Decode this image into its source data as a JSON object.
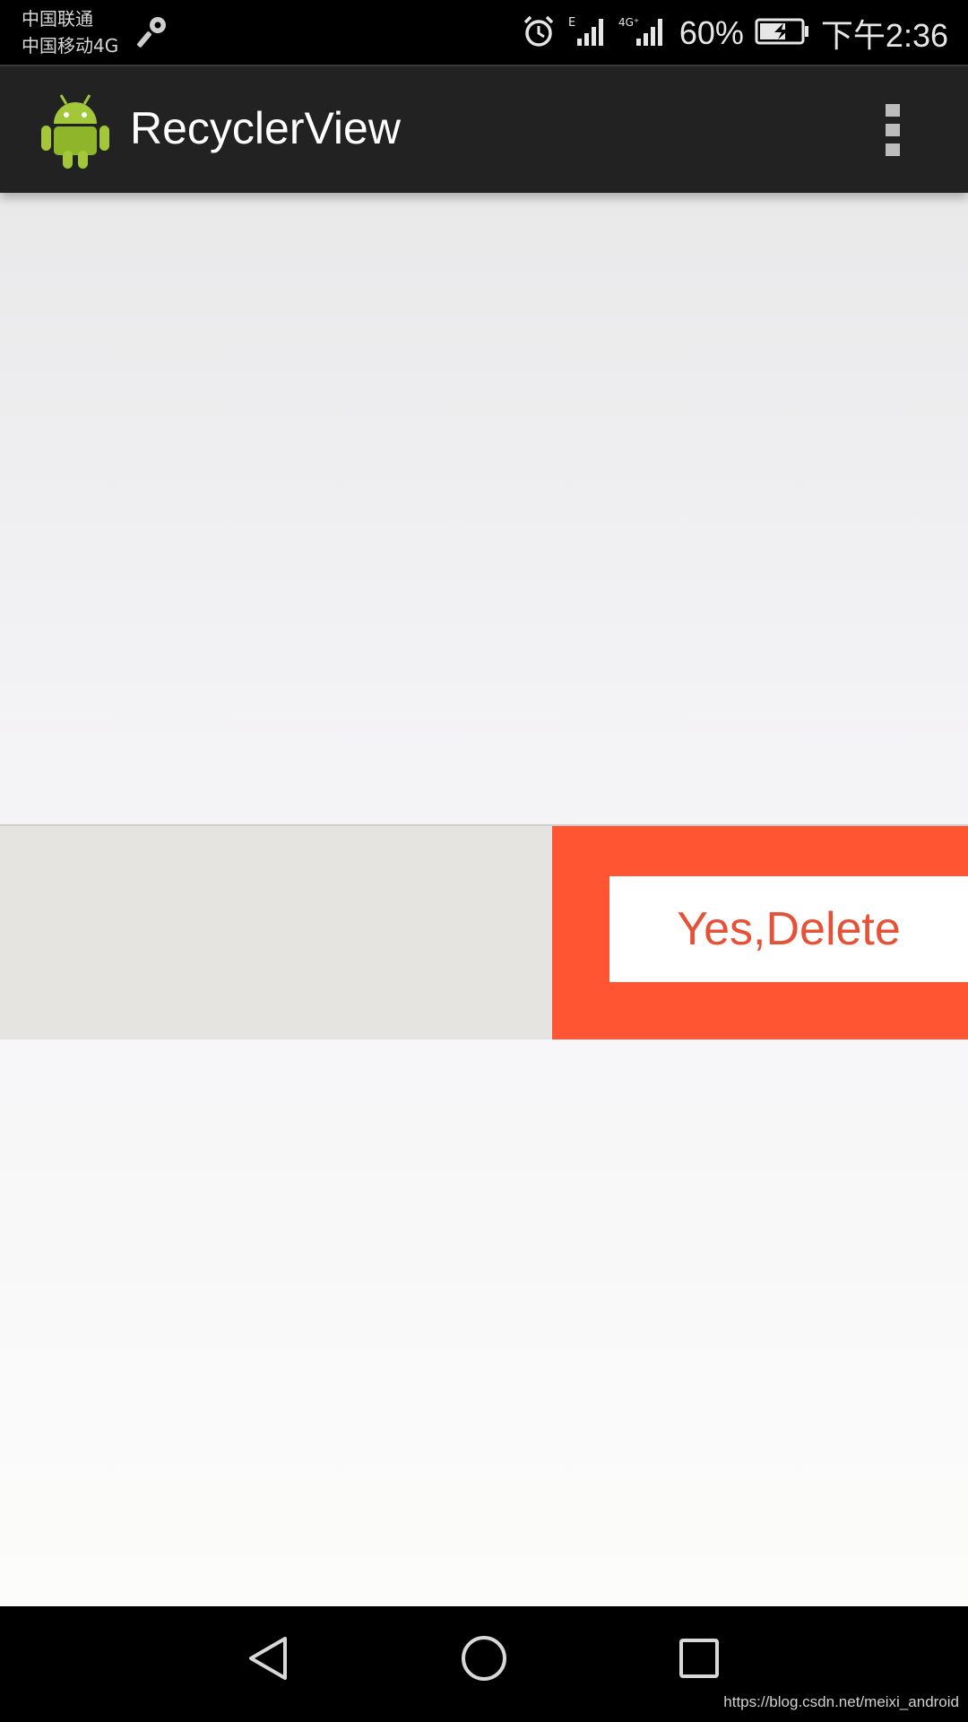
{
  "status_bar": {
    "carrier_1": "中国联通",
    "carrier_2": "中国移动4G",
    "battery": "60%",
    "time": "下午2:36",
    "icons": [
      "key-icon",
      "alarm-icon",
      "signal-e-icon",
      "signal-4g-icon",
      "battery-charging-icon"
    ]
  },
  "app_bar": {
    "title": "RecyclerView",
    "icon": "android-icon",
    "menu_icon": "overflow-menu-icon"
  },
  "list": {
    "swiped_item": {
      "delete_label": "Yes,Delete",
      "delete_bg": "#ff5533",
      "delete_text_color": "#e65237"
    }
  },
  "nav_bar": {
    "buttons": [
      "back-icon",
      "home-icon",
      "recents-icon"
    ]
  },
  "watermark": "https://blog.csdn.net/meixi_android"
}
